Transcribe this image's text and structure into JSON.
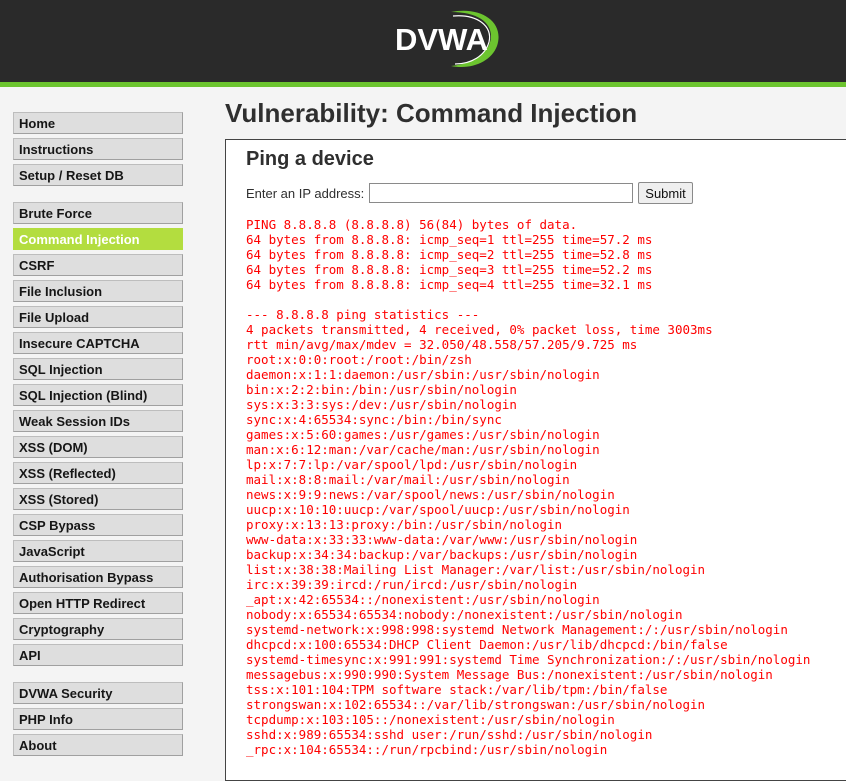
{
  "header": {
    "logo_text": "DVWA",
    "accent_color": "#6cc42f"
  },
  "sidebar": {
    "group1": [
      {
        "label": "Home"
      },
      {
        "label": "Instructions"
      },
      {
        "label": "Setup / Reset DB"
      }
    ],
    "group2": [
      {
        "label": "Brute Force"
      },
      {
        "label": "Command Injection",
        "selected": true
      },
      {
        "label": "CSRF"
      },
      {
        "label": "File Inclusion"
      },
      {
        "label": "File Upload"
      },
      {
        "label": "Insecure CAPTCHA"
      },
      {
        "label": "SQL Injection"
      },
      {
        "label": "SQL Injection (Blind)"
      },
      {
        "label": "Weak Session IDs"
      },
      {
        "label": "XSS (DOM)"
      },
      {
        "label": "XSS (Reflected)"
      },
      {
        "label": "XSS (Stored)"
      },
      {
        "label": "CSP Bypass"
      },
      {
        "label": "JavaScript"
      },
      {
        "label": "Authorisation Bypass"
      },
      {
        "label": "Open HTTP Redirect"
      },
      {
        "label": "Cryptography"
      },
      {
        "label": "API"
      }
    ],
    "group3": [
      {
        "label": "DVWA Security"
      },
      {
        "label": "PHP Info"
      },
      {
        "label": "About"
      }
    ]
  },
  "main": {
    "page_title": "Vulnerability: Command Injection",
    "section_title": "Ping a device",
    "ip_label": "Enter an IP address:",
    "ip_value": "",
    "submit_label": "Submit",
    "output_lines": [
      "PING 8.8.8.8 (8.8.8.8) 56(84) bytes of data.",
      "64 bytes from 8.8.8.8: icmp_seq=1 ttl=255 time=57.2 ms",
      "64 bytes from 8.8.8.8: icmp_seq=2 ttl=255 time=52.8 ms",
      "64 bytes from 8.8.8.8: icmp_seq=3 ttl=255 time=52.2 ms",
      "64 bytes from 8.8.8.8: icmp_seq=4 ttl=255 time=32.1 ms",
      "",
      "--- 8.8.8.8 ping statistics ---",
      "4 packets transmitted, 4 received, 0% packet loss, time 3003ms",
      "rtt min/avg/max/mdev = 32.050/48.558/57.205/9.725 ms",
      "root:x:0:0:root:/root:/bin/zsh",
      "daemon:x:1:1:daemon:/usr/sbin:/usr/sbin/nologin",
      "bin:x:2:2:bin:/bin:/usr/sbin/nologin",
      "sys:x:3:3:sys:/dev:/usr/sbin/nologin",
      "sync:x:4:65534:sync:/bin:/bin/sync",
      "games:x:5:60:games:/usr/games:/usr/sbin/nologin",
      "man:x:6:12:man:/var/cache/man:/usr/sbin/nologin",
      "lp:x:7:7:lp:/var/spool/lpd:/usr/sbin/nologin",
      "mail:x:8:8:mail:/var/mail:/usr/sbin/nologin",
      "news:x:9:9:news:/var/spool/news:/usr/sbin/nologin",
      "uucp:x:10:10:uucp:/var/spool/uucp:/usr/sbin/nologin",
      "proxy:x:13:13:proxy:/bin:/usr/sbin/nologin",
      "www-data:x:33:33:www-data:/var/www:/usr/sbin/nologin",
      "backup:x:34:34:backup:/var/backups:/usr/sbin/nologin",
      "list:x:38:38:Mailing List Manager:/var/list:/usr/sbin/nologin",
      "irc:x:39:39:ircd:/run/ircd:/usr/sbin/nologin",
      "_apt:x:42:65534::/nonexistent:/usr/sbin/nologin",
      "nobody:x:65534:65534:nobody:/nonexistent:/usr/sbin/nologin",
      "systemd-network:x:998:998:systemd Network Management:/:/usr/sbin/nologin",
      "dhcpcd:x:100:65534:DHCP Client Daemon:/usr/lib/dhcpcd:/bin/false",
      "systemd-timesync:x:991:991:systemd Time Synchronization:/:/usr/sbin/nologin",
      "messagebus:x:990:990:System Message Bus:/nonexistent:/usr/sbin/nologin",
      "tss:x:101:104:TPM software stack:/var/lib/tpm:/bin/false",
      "strongswan:x:102:65534::/var/lib/strongswan:/usr/sbin/nologin",
      "tcpdump:x:103:105::/nonexistent:/usr/sbin/nologin",
      "sshd:x:989:65534:sshd user:/run/sshd:/usr/sbin/nologin",
      "_rpc:x:104:65534::/run/rpcbind:/usr/sbin/nologin"
    ],
    "output_color": "#ff0000"
  }
}
